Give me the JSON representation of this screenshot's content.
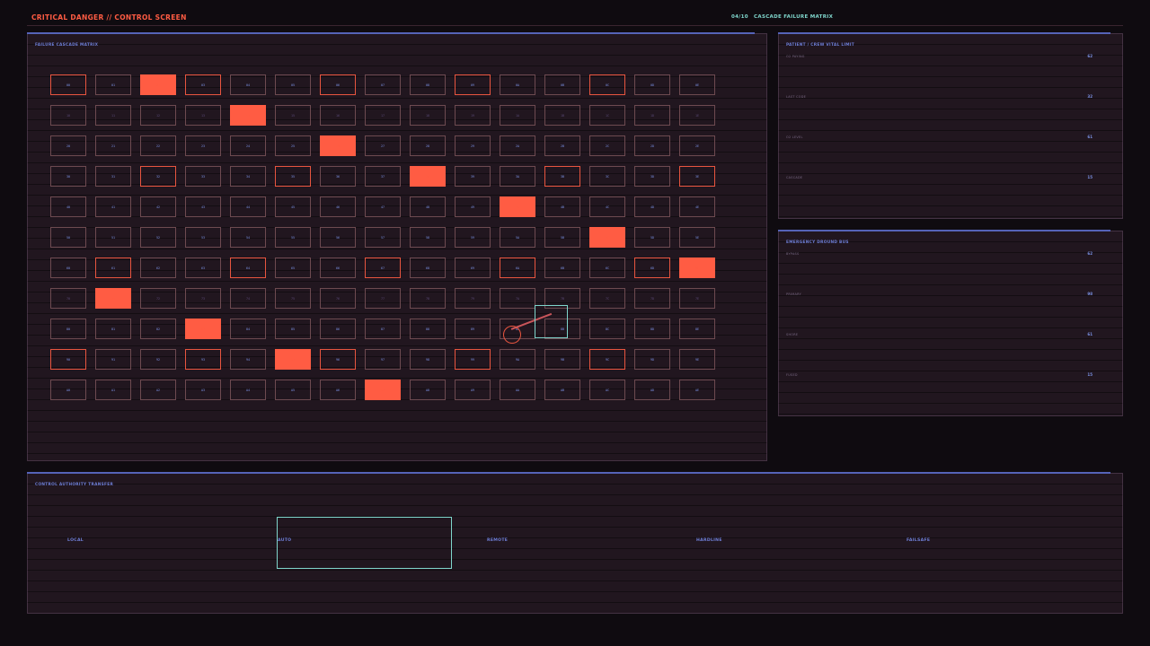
{
  "header": {
    "title": "CRITICAL DANGER // CONTROL SCREEN",
    "step": "04/10",
    "step_title": "CASCADE FAILURE MATRIX"
  },
  "colors": {
    "danger": "#ff5c43",
    "accent_blue": "#6f7fd8",
    "accent_teal": "#7fd6cc",
    "panel_bg": "#21161f",
    "page_bg": "#0f0b10"
  },
  "matrix": {
    "title": "FAILURE CASCADE MATRIX",
    "rows": [
      {
        "labels": [
          "00",
          "01",
          "02",
          "03",
          "04",
          "05",
          "06",
          "07",
          "08",
          "09",
          "0A",
          "0B",
          "0C",
          "0D",
          "0E"
        ],
        "states": [
          "warn",
          "normal",
          "crit",
          "warn",
          "normal",
          "normal",
          "warn",
          "normal",
          "normal",
          "warn",
          "normal",
          "normal",
          "warn",
          "normal",
          "normal"
        ]
      },
      {
        "labels": [
          "10",
          "11",
          "12",
          "13",
          "14",
          "15",
          "16",
          "17",
          "18",
          "19",
          "1A",
          "1B",
          "1C",
          "1D",
          "1E"
        ],
        "states": [
          "dim",
          "dim",
          "dim",
          "dim",
          "crit",
          "dim",
          "dim",
          "dim",
          "dim",
          "dim",
          "dim",
          "dim",
          "dim",
          "dim",
          "dim"
        ]
      },
      {
        "labels": [
          "20",
          "21",
          "22",
          "23",
          "24",
          "25",
          "26",
          "27",
          "28",
          "29",
          "2A",
          "2B",
          "2C",
          "2D",
          "2E"
        ],
        "states": [
          "normal",
          "normal",
          "normal",
          "normal",
          "normal",
          "normal",
          "crit",
          "normal",
          "normal",
          "normal",
          "normal",
          "normal",
          "normal",
          "normal",
          "normal"
        ]
      },
      {
        "labels": [
          "30",
          "31",
          "32",
          "33",
          "34",
          "35",
          "36",
          "37",
          "38",
          "39",
          "3A",
          "3B",
          "3C",
          "3D",
          "3E"
        ],
        "states": [
          "normal",
          "normal",
          "warn",
          "normal",
          "normal",
          "warn",
          "normal",
          "normal",
          "crit",
          "normal",
          "normal",
          "warn",
          "normal",
          "normal",
          "warn"
        ]
      },
      {
        "labels": [
          "40",
          "41",
          "42",
          "43",
          "44",
          "45",
          "46",
          "47",
          "48",
          "49",
          "4A",
          "4B",
          "4C",
          "4D",
          "4E"
        ],
        "states": [
          "normal",
          "normal",
          "normal",
          "normal",
          "normal",
          "normal",
          "normal",
          "normal",
          "normal",
          "normal",
          "crit",
          "normal",
          "normal",
          "normal",
          "normal"
        ]
      },
      {
        "labels": [
          "50",
          "51",
          "52",
          "53",
          "54",
          "55",
          "56",
          "57",
          "58",
          "59",
          "5A",
          "5B",
          "5C",
          "5D",
          "5E"
        ],
        "states": [
          "normal",
          "normal",
          "normal",
          "normal",
          "normal",
          "normal",
          "normal",
          "normal",
          "normal",
          "normal",
          "normal",
          "normal",
          "crit",
          "normal",
          "normal"
        ]
      },
      {
        "labels": [
          "60",
          "61",
          "62",
          "63",
          "64",
          "65",
          "66",
          "67",
          "68",
          "69",
          "6A",
          "6B",
          "6C",
          "6D",
          "6E"
        ],
        "states": [
          "normal",
          "warn",
          "normal",
          "normal",
          "warn",
          "normal",
          "normal",
          "warn",
          "normal",
          "normal",
          "warn",
          "normal",
          "normal",
          "warn",
          "crit"
        ]
      },
      {
        "labels": [
          "70",
          "71",
          "72",
          "73",
          "74",
          "75",
          "76",
          "77",
          "78",
          "79",
          "7A",
          "7B",
          "7C",
          "7D",
          "7E"
        ],
        "states": [
          "dim",
          "crit",
          "dim",
          "dim",
          "dim",
          "dim",
          "dim",
          "dim",
          "dim",
          "dim",
          "dim",
          "dim",
          "dim",
          "dim",
          "dim"
        ]
      },
      {
        "labels": [
          "80",
          "81",
          "82",
          "83",
          "84",
          "85",
          "86",
          "87",
          "88",
          "89",
          "8A",
          "8B",
          "8C",
          "8D",
          "8E"
        ],
        "states": [
          "normal",
          "normal",
          "normal",
          "crit",
          "normal",
          "normal",
          "normal",
          "normal",
          "normal",
          "normal",
          "normal",
          "normal",
          "normal",
          "normal",
          "normal"
        ]
      },
      {
        "labels": [
          "90",
          "91",
          "92",
          "93",
          "94",
          "95",
          "96",
          "97",
          "98",
          "99",
          "9A",
          "9B",
          "9C",
          "9D",
          "9E"
        ],
        "states": [
          "warn",
          "normal",
          "normal",
          "warn",
          "normal",
          "crit",
          "warn",
          "normal",
          "normal",
          "warn",
          "normal",
          "normal",
          "warn",
          "normal",
          "normal"
        ]
      },
      {
        "labels": [
          "A0",
          "A1",
          "A2",
          "A3",
          "A4",
          "A5",
          "A6",
          "A7",
          "A8",
          "A9",
          "AA",
          "AB",
          "AC",
          "AD",
          "AE"
        ],
        "states": [
          "normal",
          "normal",
          "normal",
          "normal",
          "normal",
          "normal",
          "normal",
          "crit",
          "normal",
          "normal",
          "normal",
          "normal",
          "normal",
          "normal",
          "normal"
        ]
      }
    ],
    "cursor_cell": "8B",
    "ring_cell": "8A"
  },
  "vitals": {
    "title": "PATIENT / CREW VITAL LIMIT",
    "items": [
      {
        "label": "O2 PAYING",
        "value": "62"
      },
      {
        "label": "LAST CODE",
        "value": "32"
      },
      {
        "label": "O2 LEVEL",
        "value": "61"
      },
      {
        "label": "CASCADE",
        "value": "15"
      }
    ]
  },
  "bus": {
    "title": "EMERGENCY DROUND BUS",
    "items": [
      {
        "label": "BYPASS",
        "value": "62"
      },
      {
        "label": "PRIMARY",
        "value": "98"
      },
      {
        "label": "SHORE",
        "value": "61"
      },
      {
        "label": "FUSED",
        "value": "15"
      }
    ]
  },
  "authority": {
    "title": "CONTROL AUTHORITY TRANSFER",
    "options": [
      "LOCAL",
      "AUTO",
      "REMOTE",
      "HARDLINE",
      "FAILSAFE"
    ],
    "selected": "AUTO"
  }
}
